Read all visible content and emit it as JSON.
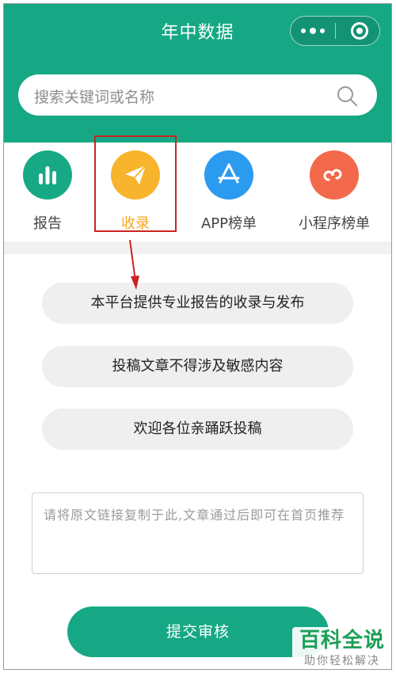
{
  "header": {
    "title": "年中数据"
  },
  "search": {
    "placeholder": "搜索关键词或名称"
  },
  "categories": [
    {
      "label": "报告",
      "icon": "bar-chart-icon",
      "color": "#17a985"
    },
    {
      "label": "收录",
      "icon": "paper-plane-icon",
      "color": "#f7b42c"
    },
    {
      "label": "APP榜单",
      "icon": "app-store-icon",
      "color": "#2b9bf0"
    },
    {
      "label": "小程序榜单",
      "icon": "mini-program-icon",
      "color": "#f26a4b"
    }
  ],
  "info": [
    "本平台提供专业报告的收录与发布",
    "投稿文章不得涉及敏感内容",
    "欢迎各位亲踊跃投稿"
  ],
  "link_input": {
    "placeholder": "请将原文链接复制于此,文章通过后即可在首页推荐"
  },
  "submit_label": "提交审核",
  "watermark": {
    "title": "百科全说",
    "subtitle": "助你轻松解决"
  },
  "colors": {
    "brand": "#16a884",
    "highlight": "#cc2222"
  }
}
